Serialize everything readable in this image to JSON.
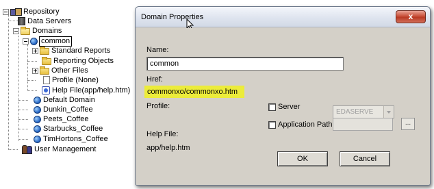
{
  "tree": {
    "root": "Repository",
    "data_servers": "Data Servers",
    "domains": "Domains",
    "common": "common",
    "standard_reports": "Standard Reports",
    "reporting_objects": "Reporting Objects",
    "other_files": "Other Files",
    "profile": "Profile (None)",
    "help_file": "Help File(app/help.htm)",
    "default_domain": "Default Domain",
    "dunkin": "Dunkin_Coffee",
    "peets": "Peets_Coffee",
    "starbucks": "Starbucks_Coffee",
    "timhortons": "TimHortons_Coffee",
    "user_management": "User Management"
  },
  "dialog": {
    "title": "Domain Properties",
    "close_glyph": "x",
    "name_label": "Name:",
    "name_value": "common",
    "href_label": "Href:",
    "href_value": "commonxo/commonxo.htm",
    "profile_label": "Profile:",
    "server_label": "Server",
    "server_value": "EDASERVE",
    "app_path_label": "Application Path",
    "browse_label": "...",
    "help_file_label": "Help File:",
    "help_file_value": "app/help.htm",
    "ok_label": "OK",
    "cancel_label": "Cancel"
  },
  "colors": {
    "href_highlight": "#ecec3a",
    "close_button": "#c9503a"
  },
  "icons": {
    "repository": "repository-icon",
    "data_servers": "server-icon",
    "folder": "folder-icon",
    "domain": "globe-icon",
    "profile": "document-icon",
    "help_file": "help-file-icon",
    "users": "users-icon"
  }
}
